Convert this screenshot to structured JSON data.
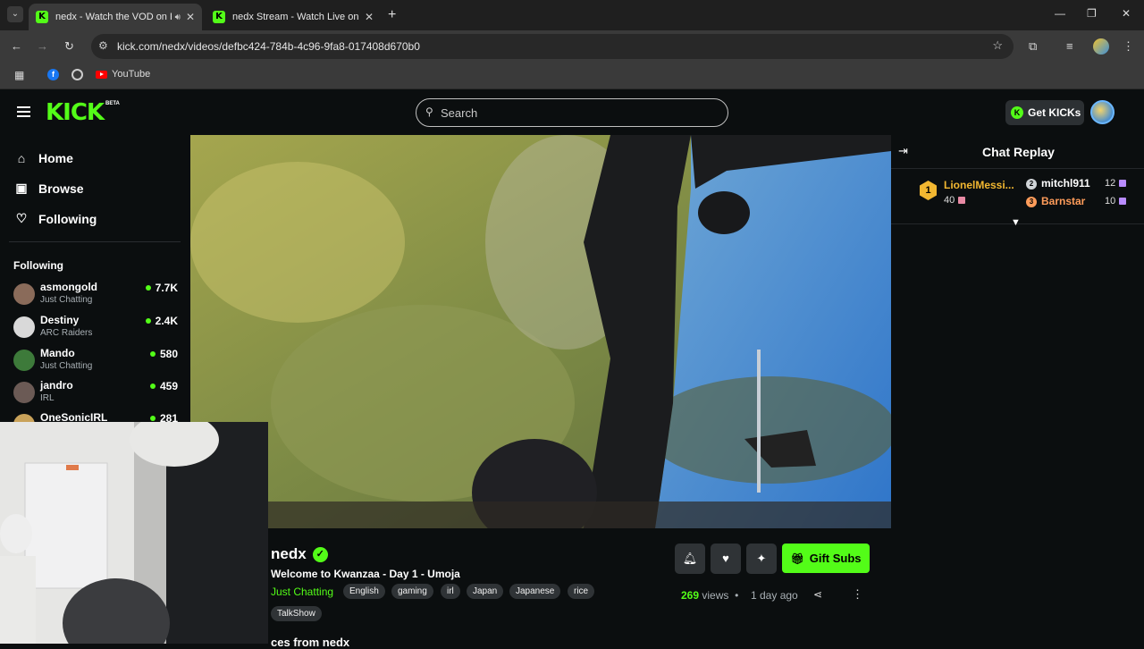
{
  "browser": {
    "tabs": [
      {
        "title": "nedx - Watch the VOD on Ki",
        "favicon": "K",
        "active": true
      },
      {
        "title": "nedx Stream - Watch Live on Ki",
        "favicon": "K",
        "active": false
      }
    ],
    "url": "kick.com/nedx/videos/defbc424-784b-4c96-9fa8-017408d670b0",
    "bookmarks": [
      {
        "label": "YouTube"
      }
    ]
  },
  "header": {
    "logo": "KICK",
    "logo_badge": "BETA",
    "search_placeholder": "Search",
    "get_kicks_label": "Get KICKs"
  },
  "sidebar": {
    "nav": [
      {
        "label": "Home",
        "icon": "home-icon"
      },
      {
        "label": "Browse",
        "icon": "browse-icon"
      },
      {
        "label": "Following",
        "icon": "heart-icon"
      }
    ],
    "following_heading": "Following",
    "channels": [
      {
        "name": "asmongold",
        "category": "Just Chatting",
        "viewers": "7.7K",
        "avatar_color": "#8a6b5a"
      },
      {
        "name": "Destiny",
        "category": "ARC Raiders",
        "viewers": "2.4K",
        "avatar_color": "#d9d9d9"
      },
      {
        "name": "Mando",
        "category": "Just Chatting",
        "viewers": "580",
        "avatar_color": "#3d7a3a"
      },
      {
        "name": "jandro",
        "category": "IRL",
        "viewers": "459",
        "avatar_color": "#6b5a55"
      },
      {
        "name": "OneSonicIRL",
        "category": "",
        "viewers": "281",
        "avatar_color": "#c9a25a"
      }
    ]
  },
  "video_info": {
    "streamer": "nedx",
    "title": "Welcome to Kwanzaa - Day 1 - Umoja",
    "category": "Just Chatting",
    "tags": [
      "English",
      "gaming",
      "irl",
      "Japan",
      "Japanese",
      "rice",
      "TalkShow"
    ],
    "gift_subs_label": "Gift Subs",
    "views_count": "269",
    "views_label": "views",
    "separator": "•",
    "posted": "1 day ago",
    "section_heading_partial": "ces from nedx"
  },
  "chat": {
    "title": "Chat Replay",
    "leaderboard": [
      {
        "rank": "1",
        "name": "LionelMessi...",
        "count": "40"
      },
      {
        "rank": "2",
        "name": "mitchl911",
        "count": "12"
      },
      {
        "rank": "3",
        "name": "Barnstar",
        "count": "10"
      }
    ]
  },
  "colors": {
    "brand_green": "#53fc18",
    "gold": "#f2b731",
    "bronze": "#ff9c5a"
  }
}
